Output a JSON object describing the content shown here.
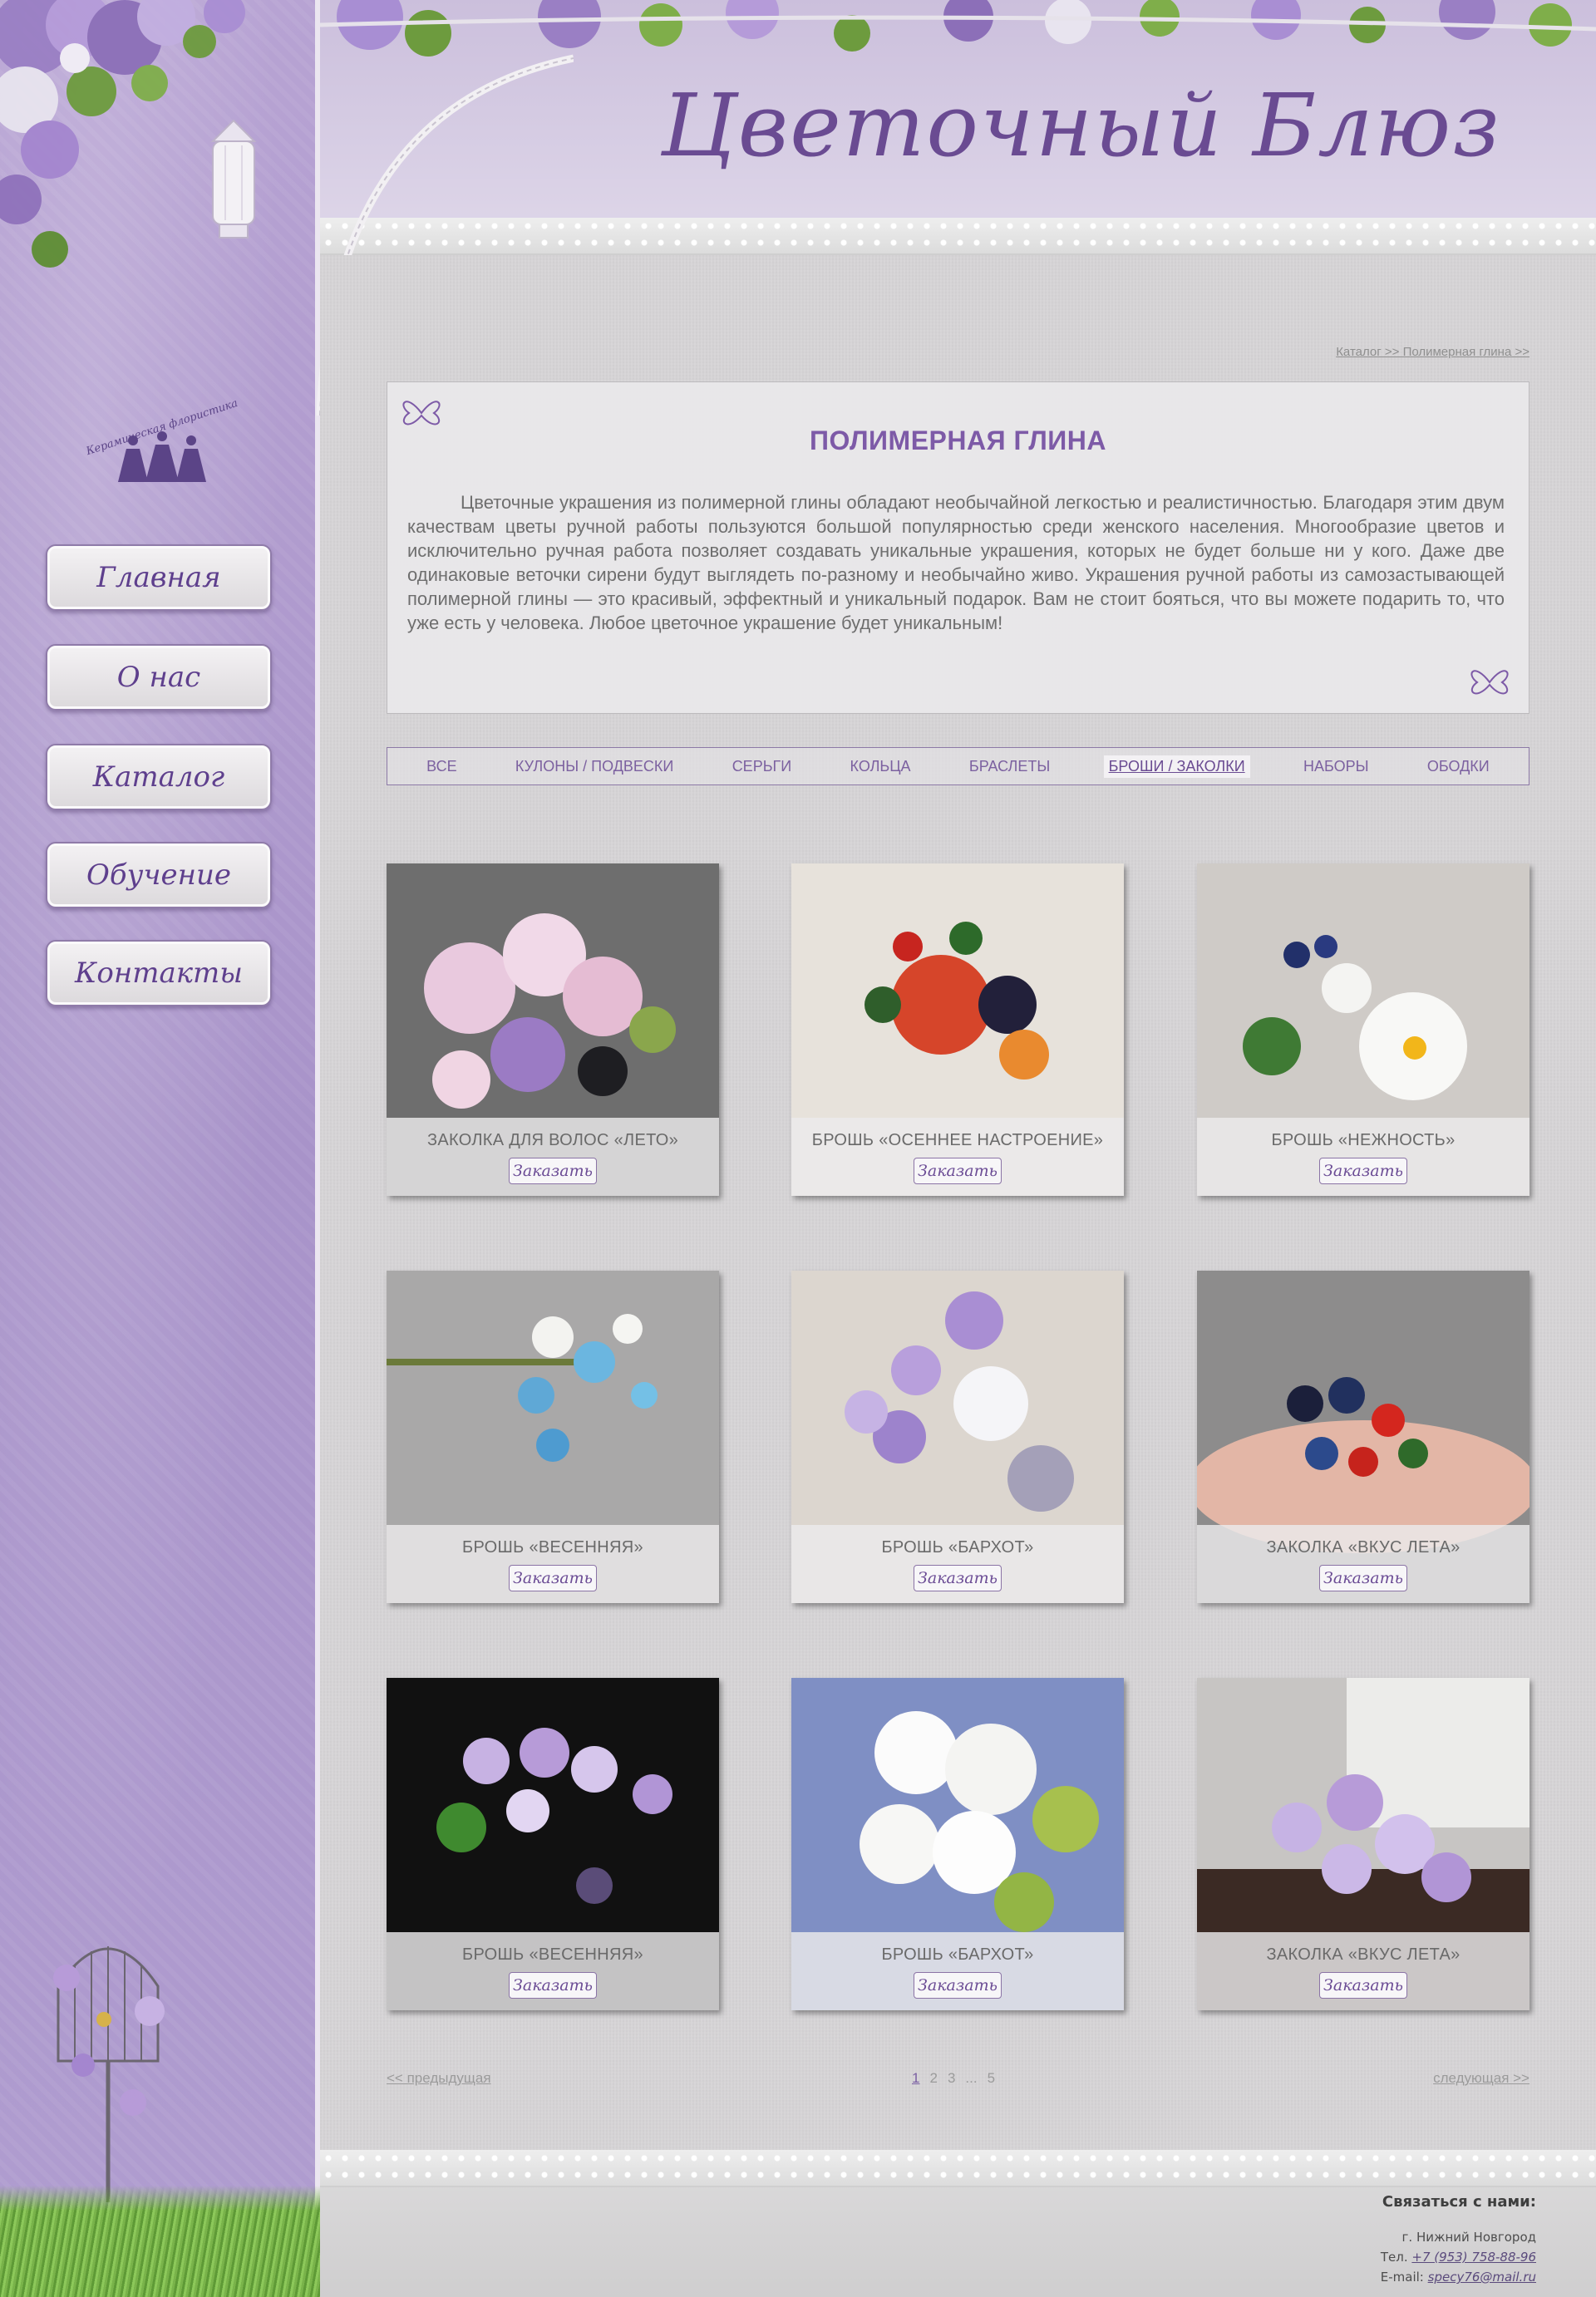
{
  "site": {
    "title": "Цветочный Блюз"
  },
  "logo": {
    "text": "Керамическая флористика"
  },
  "nav": {
    "items": [
      {
        "label": "Главная"
      },
      {
        "label": "О нас"
      },
      {
        "label": "Каталог"
      },
      {
        "label": "Обучение"
      },
      {
        "label": "Контакты"
      }
    ]
  },
  "breadcrumb": "Каталог >> Полимерная глина >>",
  "intro": {
    "title": "ПОЛИМЕРНАЯ ГЛИНА",
    "text": "Цветочные украшения из полимерной глины обладают необычайной легкостью и реалистичностью. Благодаря этим двум качествам цветы ручной работы пользуются большой популярностью среди женского населения. Многообразие цветов и исключительно ручная работа позволяет создавать уникальные украшения, которых не будет больше ни у кого. Даже две одинаковые веточки сирени будут выглядеть по-разному и необычайно живо. Украшения ручной работы из самозастывающей полимерной глины — это красивый, эффектный и уникальный подарок. Вам не стоит бояться, что вы можете подарить то, что уже есть у человека. Любое цветочное украшение будет уникальным!"
  },
  "categories": [
    {
      "label": "ВСЕ",
      "active": false
    },
    {
      "label": "КУЛОНЫ / ПОДВЕСКИ",
      "active": false
    },
    {
      "label": "СЕРЬГИ",
      "active": false
    },
    {
      "label": "КОЛЬЦА",
      "active": false
    },
    {
      "label": "БРАСЛЕТЫ",
      "active": false
    },
    {
      "label": "БРОШИ / ЗАКОЛКИ",
      "active": true
    },
    {
      "label": "НАБОРЫ",
      "active": false
    },
    {
      "label": "ОБОДКИ",
      "active": false
    }
  ],
  "order_label": "Заказать",
  "products": [
    {
      "name": "ЗАКОЛКА ДЛЯ ВОЛОС «ЛЕТО»"
    },
    {
      "name": "БРОШЬ «ОСЕННЕЕ НАСТРОЕНИЕ»"
    },
    {
      "name": "БРОШЬ «НЕЖНОСТЬ»"
    },
    {
      "name": "БРОШЬ  «ВЕСЕННЯЯ»"
    },
    {
      "name": "БРОШЬ «БАРХОТ»"
    },
    {
      "name": "ЗАКОЛКА «ВКУС ЛЕТА»"
    },
    {
      "name": "БРОШЬ  «ВЕСЕННЯЯ»"
    },
    {
      "name": "БРОШЬ «БАРХОТ»"
    },
    {
      "name": "ЗАКОЛКА «ВКУС ЛЕТА»"
    }
  ],
  "pagination": {
    "prev": "<< предыдущая",
    "next": "следующая >>",
    "pages": [
      "1",
      "2",
      "3",
      "...",
      "5"
    ],
    "current": "1"
  },
  "footer": {
    "contacts_heading": "Связаться с нами:",
    "city": "г. Нижний Новгород",
    "phone_label": "Тел.",
    "phone": "+7 (953) 758-88-96",
    "email_label": "E-mail:",
    "email": "specy76@mail.ru"
  },
  "colors": {
    "accent": "#7d5aa7",
    "sidebar": "#a893c9",
    "content_bg": "#d6d4d6"
  }
}
